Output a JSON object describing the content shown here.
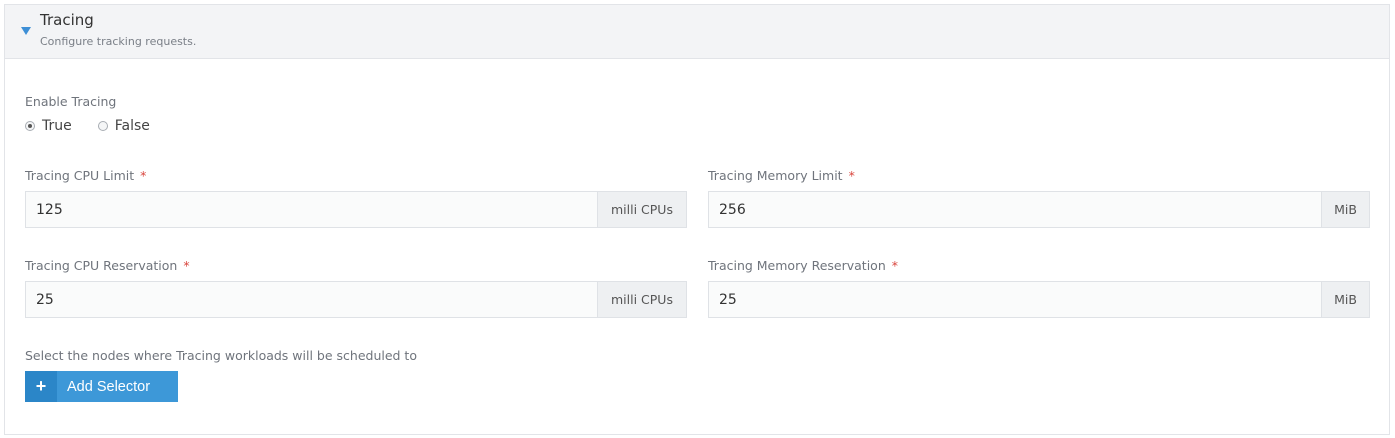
{
  "section": {
    "title": "Tracing",
    "subtitle": "Configure tracking requests."
  },
  "enable_tracing": {
    "label": "Enable Tracing",
    "options": [
      {
        "label": "True",
        "checked": true
      },
      {
        "label": "False",
        "checked": false
      }
    ]
  },
  "cpu_limit": {
    "label": "Tracing CPU Limit",
    "required": "*",
    "value": "125",
    "unit": "milli CPUs"
  },
  "memory_limit": {
    "label": "Tracing Memory Limit",
    "required": "*",
    "value": "256",
    "unit": "MiB"
  },
  "cpu_reservation": {
    "label": "Tracing CPU Reservation",
    "required": "*",
    "value": "25",
    "unit": "milli CPUs"
  },
  "memory_reservation": {
    "label": "Tracing Memory Reservation",
    "required": "*",
    "value": "25",
    "unit": "MiB"
  },
  "node_selector": {
    "label": "Select the nodes where Tracing workloads will be scheduled to",
    "button_label": "Add Selector",
    "button_icon": "plus-icon"
  },
  "colors": {
    "accent": "#3d98d8",
    "accent_dark": "#2b86c8",
    "required": "#d9453d",
    "caret": "#3d8fd6"
  }
}
